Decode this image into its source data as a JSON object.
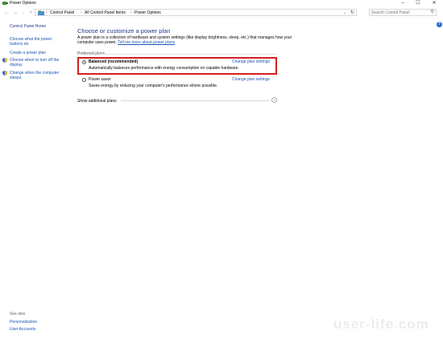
{
  "window": {
    "title": "Power Options",
    "controls": {
      "minimize": "–",
      "maximize": "☐",
      "close": "✕"
    }
  },
  "addressbar": {
    "crumbs": [
      "Control Panel",
      "All Control Panel Items",
      "Power Options"
    ],
    "search_placeholder": "Search Control Panel"
  },
  "sidebar": {
    "home": "Control Panel Home",
    "items": [
      {
        "label": "Choose what the power buttons do",
        "icon": ""
      },
      {
        "label": "Create a power plan",
        "icon": ""
      },
      {
        "label": "Choose when to turn off the display",
        "icon": "shield-icon"
      },
      {
        "label": "Change when the computer sleeps",
        "icon": "shield-icon"
      }
    ],
    "see_also": "See also",
    "see_also_links": [
      "Personalization",
      "User Accounts"
    ]
  },
  "main": {
    "title": "Choose or customize a power plan",
    "description": "A power plan is a collection of hardware and system settings (like display brightness, sleep, etc.) that manages how your computer uses power.",
    "learn_more": "Tell me more about power plans",
    "preferred_label": "Preferred plans",
    "plans": [
      {
        "name": "Balanced (recommended)",
        "description": "Automatically balances performance with energy consumption on capable hardware.",
        "link": "Change plan settings",
        "selected": true
      },
      {
        "name": "Power saver",
        "description": "Saves energy by reducing your computer's performance where possible.",
        "link": "Change plan settings",
        "selected": false
      }
    ],
    "show_additional": "Show additional plans"
  },
  "watermark": "user-life.com",
  "colors": {
    "accent": "#1a55b3",
    "highlight": "#d42020",
    "title": "#1e3a8a"
  }
}
